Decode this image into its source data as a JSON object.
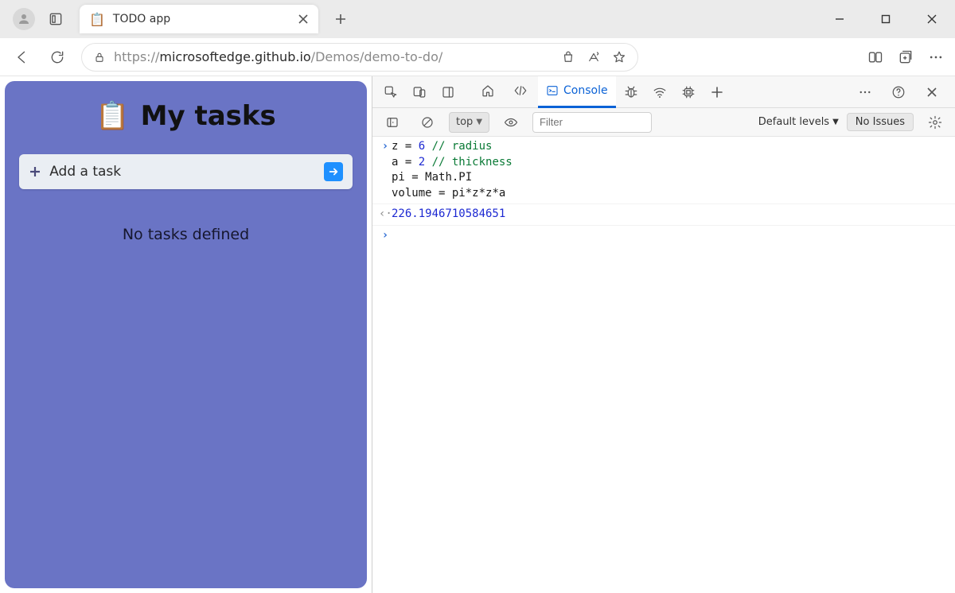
{
  "browser": {
    "tab": {
      "title": "TODO app",
      "favicon": "📋"
    },
    "url": {
      "scheme": "https://",
      "host": "microsoftedge.github.io",
      "path": "/Demos/demo-to-do/"
    }
  },
  "app": {
    "title": "My tasks",
    "icon": "📋",
    "addTaskLabel": "Add a task",
    "emptyState": "No tasks defined"
  },
  "devtools": {
    "activeTab": "Console",
    "context": "top",
    "filterPlaceholder": "Filter",
    "levels": "Default levels",
    "issues": "No Issues",
    "console": {
      "input": {
        "lines": [
          [
            {
              "t": "z ",
              "c": "var"
            },
            {
              "t": "= ",
              "c": "op"
            },
            {
              "t": "6",
              "c": "num"
            },
            {
              "t": " ",
              "c": "op"
            },
            {
              "t": "// radius",
              "c": "cmt"
            }
          ],
          [
            {
              "t": "a ",
              "c": "var"
            },
            {
              "t": "= ",
              "c": "op"
            },
            {
              "t": "2",
              "c": "num"
            },
            {
              "t": " ",
              "c": "op"
            },
            {
              "t": "// thickness",
              "c": "cmt"
            }
          ],
          [
            {
              "t": "pi ",
              "c": "var"
            },
            {
              "t": "= ",
              "c": "op"
            },
            {
              "t": "Math.PI",
              "c": "var"
            }
          ],
          [
            {
              "t": "volume ",
              "c": "var"
            },
            {
              "t": "= ",
              "c": "op"
            },
            {
              "t": "pi*z*z*a",
              "c": "var"
            }
          ]
        ]
      },
      "output": "226.1946710584651"
    }
  }
}
